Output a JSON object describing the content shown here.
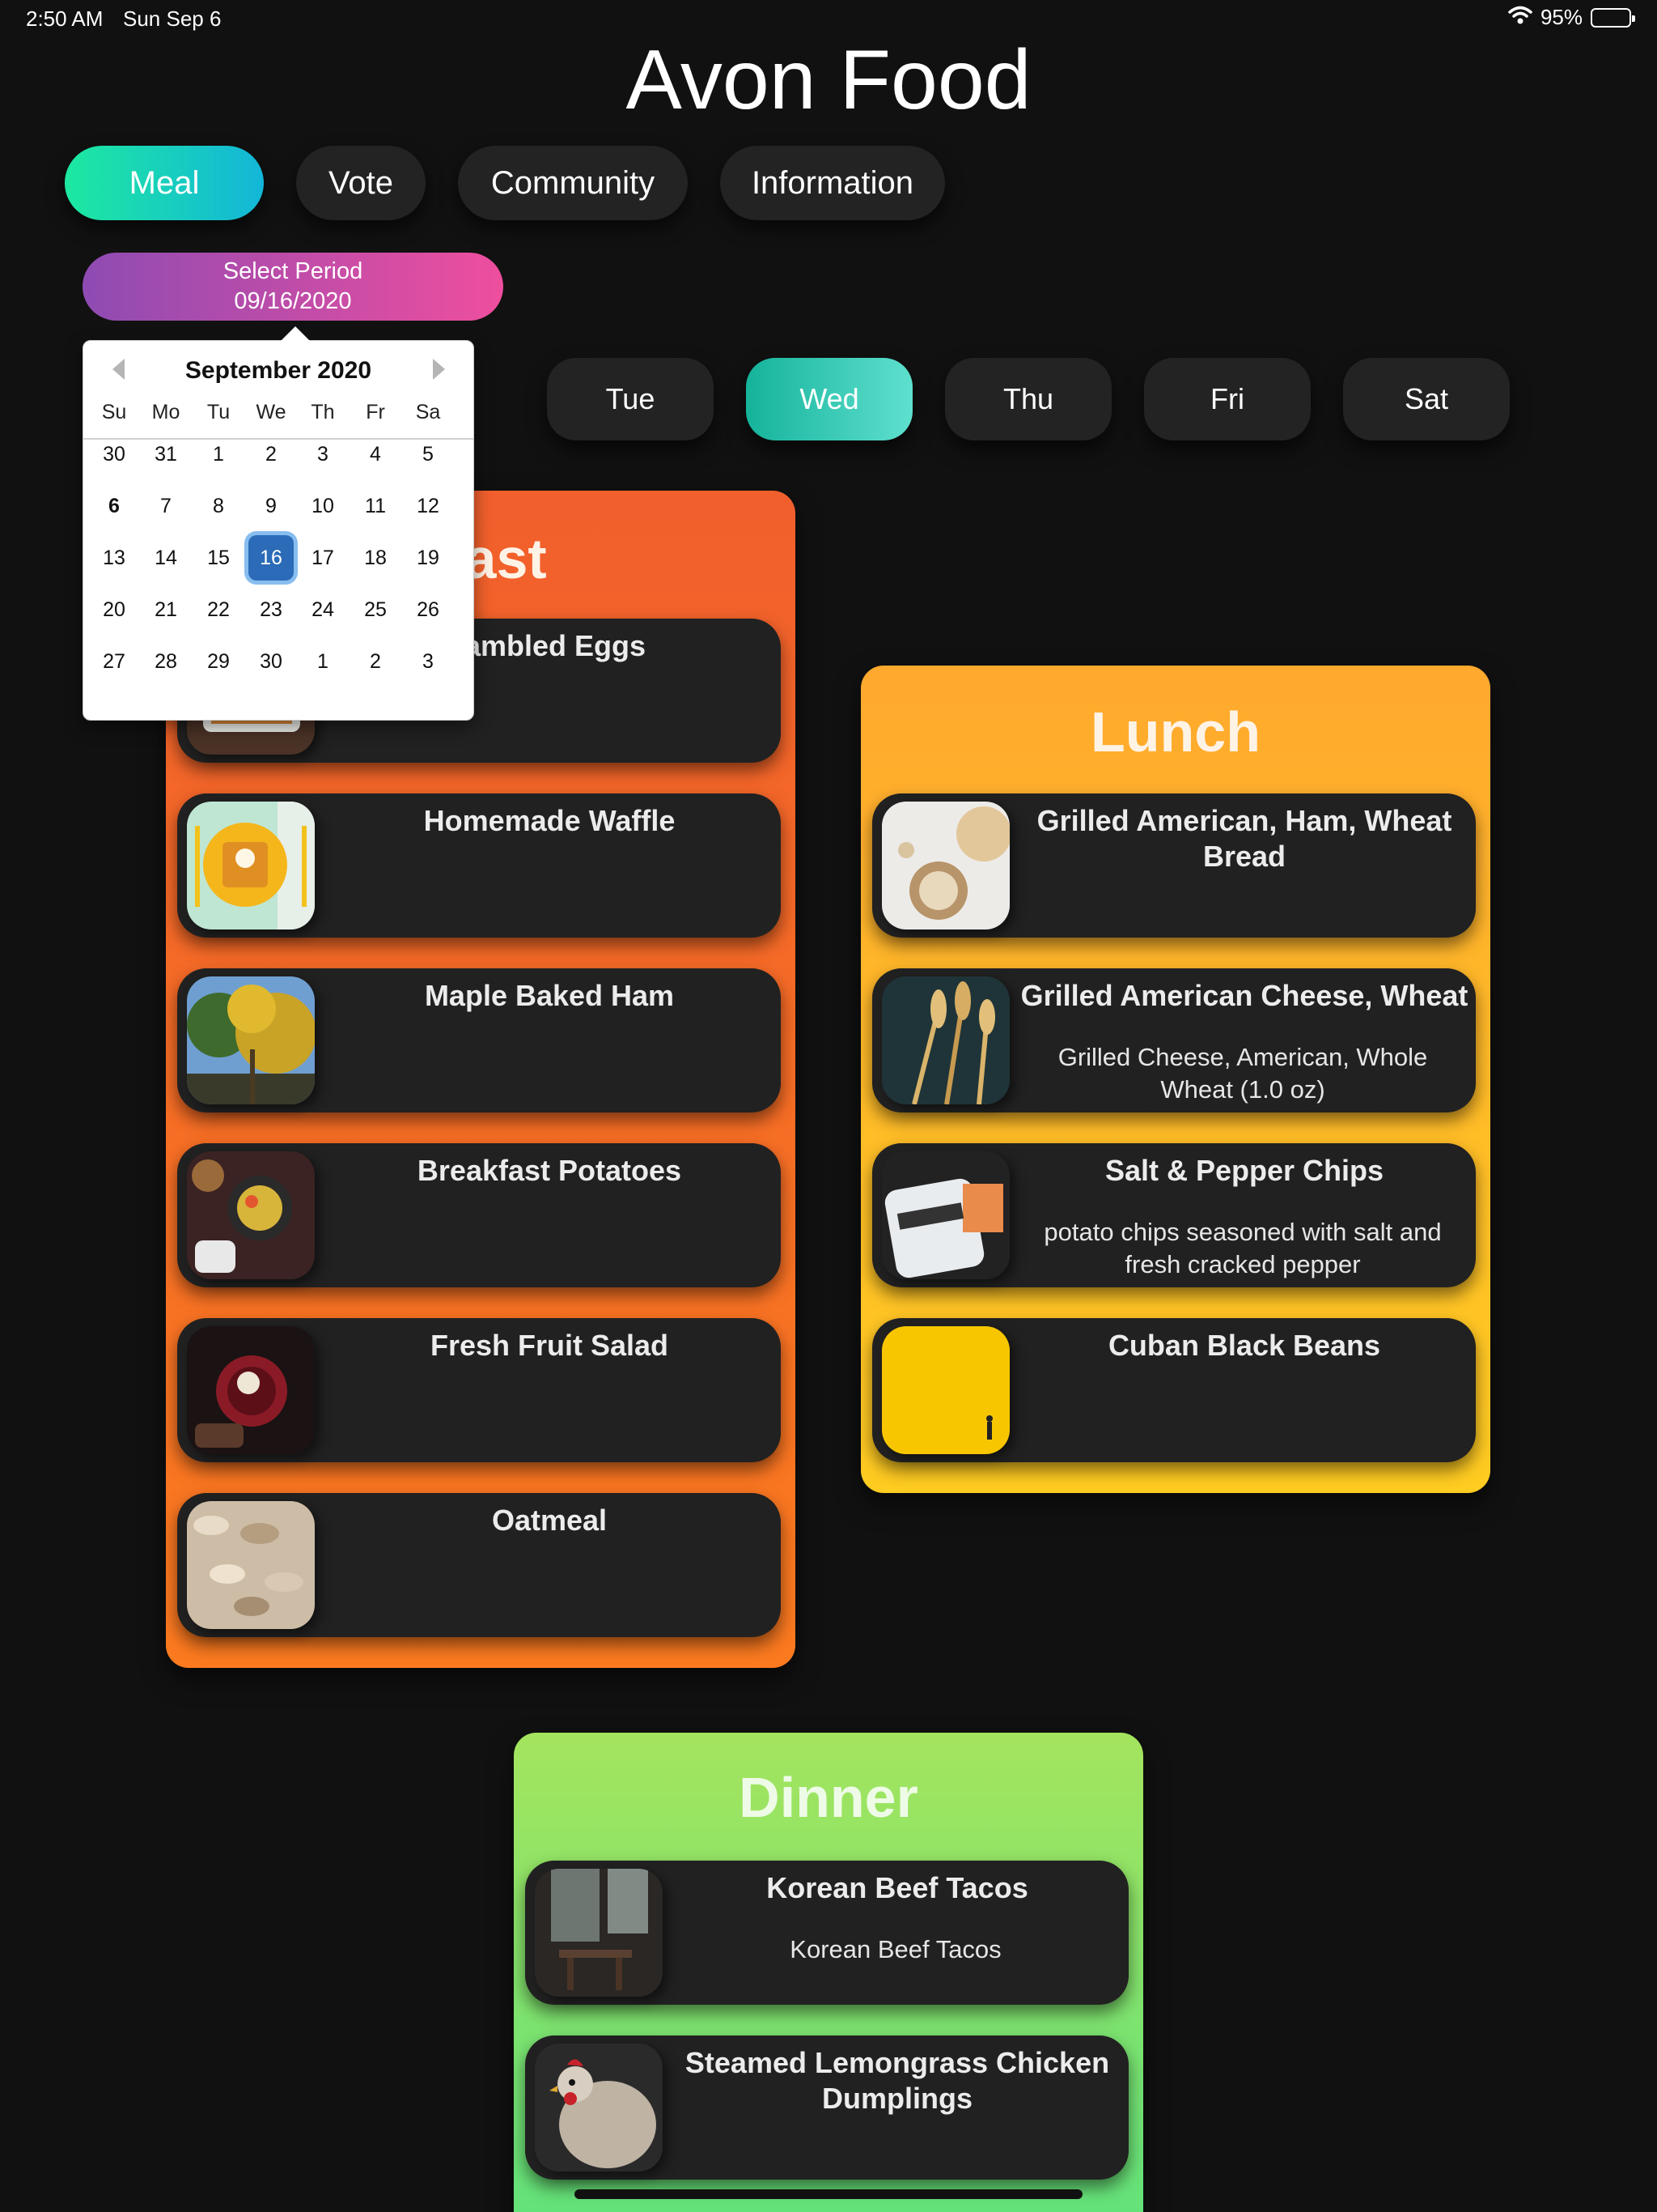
{
  "status_bar": {
    "time": "2:50 AM",
    "date": "Sun Sep 6",
    "battery": "95%",
    "battery_level": 0.95
  },
  "app": {
    "title": "Avon Food"
  },
  "nav": {
    "tabs": [
      "Meal",
      "Vote",
      "Community",
      "Information"
    ],
    "active": 0
  },
  "period": {
    "label": "Select Period",
    "value": "09/16/2020"
  },
  "days": {
    "tabs": [
      "Tue",
      "Wed",
      "Thu",
      "Fri",
      "Sat"
    ],
    "active": "Wed"
  },
  "calendar": {
    "month_label": "September 2020",
    "weekdays": [
      "Su",
      "Mo",
      "Tu",
      "We",
      "Th",
      "Fr",
      "Sa"
    ],
    "weeks": [
      [
        "30",
        "31",
        "1",
        "2",
        "3",
        "4",
        "5"
      ],
      [
        "6",
        "7",
        "8",
        "9",
        "10",
        "11",
        "12"
      ],
      [
        "13",
        "14",
        "15",
        "16",
        "17",
        "18",
        "19"
      ],
      [
        "20",
        "21",
        "22",
        "23",
        "24",
        "25",
        "26"
      ],
      [
        "27",
        "28",
        "29",
        "30",
        "1",
        "2",
        "3"
      ]
    ],
    "today": "6",
    "selected": "16"
  },
  "breakfast": {
    "title": "kfast",
    "items": [
      {
        "name": "rambled Eggs"
      },
      {
        "name": "Homemade Waffle"
      },
      {
        "name": "Maple Baked Ham"
      },
      {
        "name": "Breakfast Potatoes"
      },
      {
        "name": "Fresh Fruit Salad"
      },
      {
        "name": "Oatmeal"
      }
    ]
  },
  "lunch": {
    "title": "Lunch",
    "items": [
      {
        "name": "Grilled American, Ham, Wheat Bread",
        "description": ""
      },
      {
        "name": "Grilled American Cheese, Wheat",
        "description": "Grilled Cheese, American, Whole Wheat (1.0 oz)"
      },
      {
        "name": "Salt & Pepper Chips",
        "description": "potato chips seasoned with salt and fresh cracked pepper"
      },
      {
        "name": "Cuban Black Beans",
        "description": ""
      }
    ]
  },
  "dinner": {
    "title": "Dinner",
    "items": [
      {
        "name": "Korean Beef Tacos",
        "description": "Korean Beef Tacos"
      },
      {
        "name": "Steamed Lemongrass Chicken Dumplings",
        "description": ""
      }
    ]
  },
  "icons": {
    "wifi": "wifi-icon",
    "battery": "battery-icon",
    "calendar_prev": "chevron-left-icon",
    "calendar_next": "chevron-right-icon"
  },
  "colors": {
    "meal_tab": "#1de9a0",
    "period_button": "#ef4e9e",
    "selected_day_tab": "#15b39a",
    "breakfast_panel": "#f15f2c",
    "lunch_panel": "#ffb62a",
    "dinner_panel": "#7fe370",
    "calendar_selected": "#2b6bb7"
  }
}
